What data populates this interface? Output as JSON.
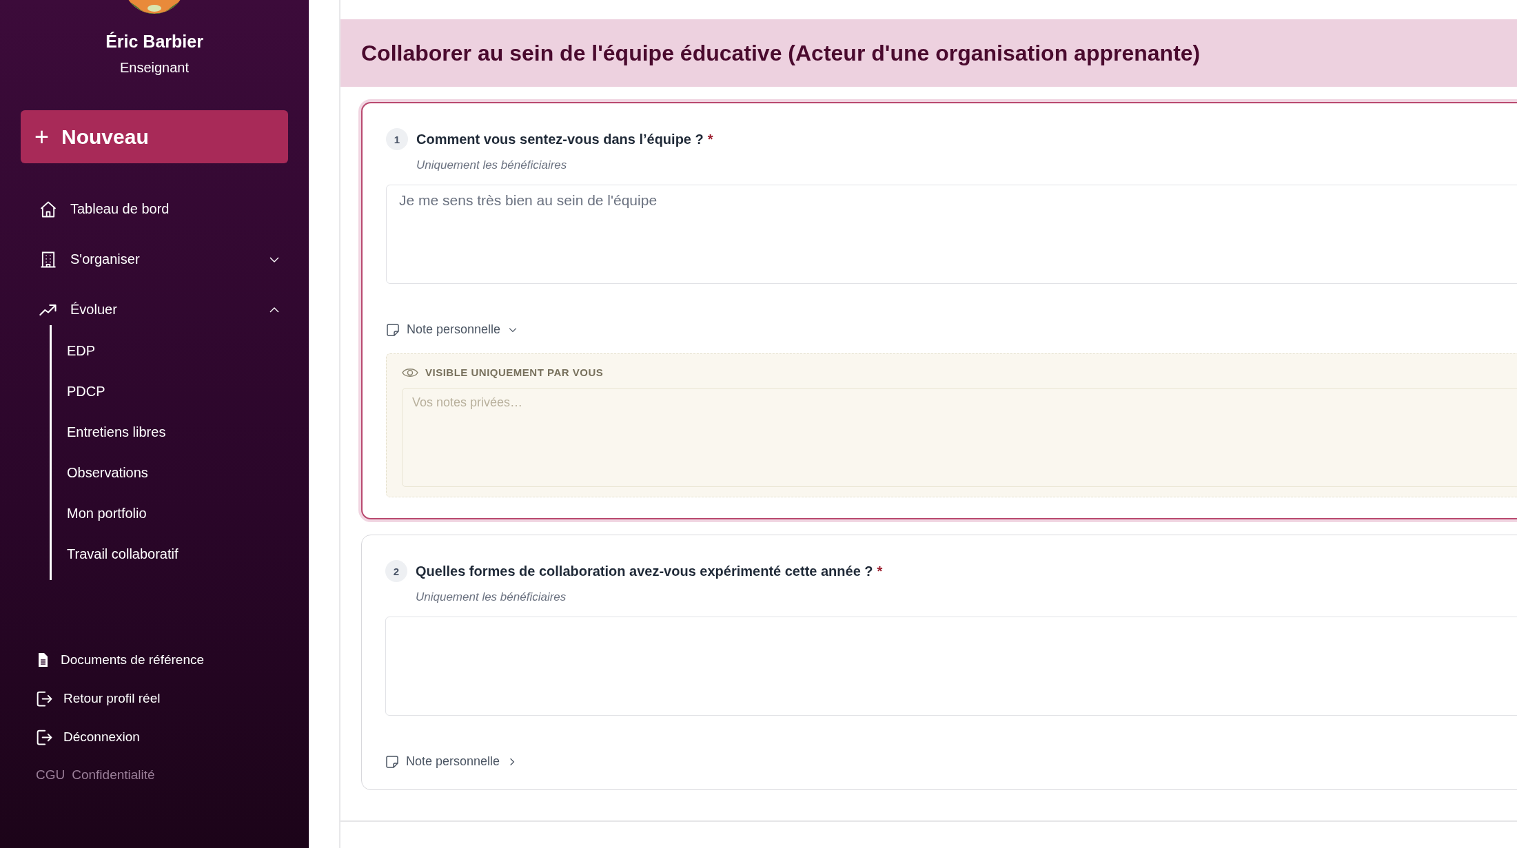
{
  "sidebar": {
    "user": {
      "name": "Éric Barbier",
      "role": "Enseignant"
    },
    "new_button": {
      "icon": "+",
      "label": "Nouveau"
    },
    "nav": [
      {
        "label": "Tableau de bord"
      },
      {
        "label": "S'organiser",
        "expanded": false
      },
      {
        "label": "Évoluer",
        "expanded": true,
        "children": [
          {
            "label": "EDP"
          },
          {
            "label": "PDCP"
          },
          {
            "label": "Entretiens libres"
          },
          {
            "label": "Observations"
          },
          {
            "label": "Mon portfolio"
          },
          {
            "label": "Travail collaboratif"
          }
        ]
      }
    ],
    "bottom_links": [
      {
        "label": "Documents de référence"
      },
      {
        "label": "Retour profil réel"
      },
      {
        "label": "Déconnexion"
      }
    ],
    "footer_links": [
      "CGU",
      "Confidentialité"
    ]
  },
  "page": {
    "title": "Collaborer au sein de l'équipe éducative (Acteur d'une organisation apprenante)",
    "questions": [
      {
        "number": "1",
        "text": "Comment vous sentez-vous dans l’équipe ?",
        "required_mark": "*",
        "subtitle": "Uniquement les bénéficiaires",
        "answer": "Je me sens très bien au sein de l'équipe",
        "selected": true,
        "note": {
          "label": "Note personnelle",
          "expanded": true,
          "visibility": "VISIBLE UNIQUEMENT PAR VOUS",
          "placeholder": "Vos notes privées…"
        }
      },
      {
        "number": "2",
        "text": "Quelles formes de collaboration avez-vous expérimenté cette année ?",
        "required_mark": "*",
        "subtitle": "Uniquement les bénéficiaires",
        "selected": false,
        "note": {
          "label": "Note personnelle",
          "expanded": false
        }
      }
    ]
  }
}
